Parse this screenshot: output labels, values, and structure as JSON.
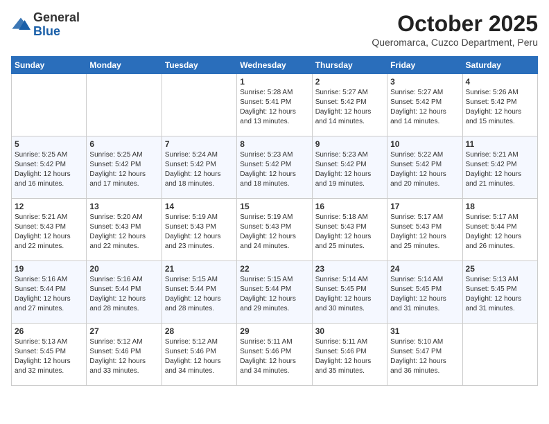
{
  "header": {
    "logo_line1": "General",
    "logo_line2": "Blue",
    "month": "October 2025",
    "location": "Queromarca, Cuzco Department, Peru"
  },
  "weekdays": [
    "Sunday",
    "Monday",
    "Tuesday",
    "Wednesday",
    "Thursday",
    "Friday",
    "Saturday"
  ],
  "weeks": [
    [
      {
        "day": "",
        "info": ""
      },
      {
        "day": "",
        "info": ""
      },
      {
        "day": "",
        "info": ""
      },
      {
        "day": "1",
        "info": "Sunrise: 5:28 AM\nSunset: 5:41 PM\nDaylight: 12 hours\nand 13 minutes."
      },
      {
        "day": "2",
        "info": "Sunrise: 5:27 AM\nSunset: 5:42 PM\nDaylight: 12 hours\nand 14 minutes."
      },
      {
        "day": "3",
        "info": "Sunrise: 5:27 AM\nSunset: 5:42 PM\nDaylight: 12 hours\nand 14 minutes."
      },
      {
        "day": "4",
        "info": "Sunrise: 5:26 AM\nSunset: 5:42 PM\nDaylight: 12 hours\nand 15 minutes."
      }
    ],
    [
      {
        "day": "5",
        "info": "Sunrise: 5:25 AM\nSunset: 5:42 PM\nDaylight: 12 hours\nand 16 minutes."
      },
      {
        "day": "6",
        "info": "Sunrise: 5:25 AM\nSunset: 5:42 PM\nDaylight: 12 hours\nand 17 minutes."
      },
      {
        "day": "7",
        "info": "Sunrise: 5:24 AM\nSunset: 5:42 PM\nDaylight: 12 hours\nand 18 minutes."
      },
      {
        "day": "8",
        "info": "Sunrise: 5:23 AM\nSunset: 5:42 PM\nDaylight: 12 hours\nand 18 minutes."
      },
      {
        "day": "9",
        "info": "Sunrise: 5:23 AM\nSunset: 5:42 PM\nDaylight: 12 hours\nand 19 minutes."
      },
      {
        "day": "10",
        "info": "Sunrise: 5:22 AM\nSunset: 5:42 PM\nDaylight: 12 hours\nand 20 minutes."
      },
      {
        "day": "11",
        "info": "Sunrise: 5:21 AM\nSunset: 5:42 PM\nDaylight: 12 hours\nand 21 minutes."
      }
    ],
    [
      {
        "day": "12",
        "info": "Sunrise: 5:21 AM\nSunset: 5:43 PM\nDaylight: 12 hours\nand 22 minutes."
      },
      {
        "day": "13",
        "info": "Sunrise: 5:20 AM\nSunset: 5:43 PM\nDaylight: 12 hours\nand 22 minutes."
      },
      {
        "day": "14",
        "info": "Sunrise: 5:19 AM\nSunset: 5:43 PM\nDaylight: 12 hours\nand 23 minutes."
      },
      {
        "day": "15",
        "info": "Sunrise: 5:19 AM\nSunset: 5:43 PM\nDaylight: 12 hours\nand 24 minutes."
      },
      {
        "day": "16",
        "info": "Sunrise: 5:18 AM\nSunset: 5:43 PM\nDaylight: 12 hours\nand 25 minutes."
      },
      {
        "day": "17",
        "info": "Sunrise: 5:17 AM\nSunset: 5:43 PM\nDaylight: 12 hours\nand 25 minutes."
      },
      {
        "day": "18",
        "info": "Sunrise: 5:17 AM\nSunset: 5:44 PM\nDaylight: 12 hours\nand 26 minutes."
      }
    ],
    [
      {
        "day": "19",
        "info": "Sunrise: 5:16 AM\nSunset: 5:44 PM\nDaylight: 12 hours\nand 27 minutes."
      },
      {
        "day": "20",
        "info": "Sunrise: 5:16 AM\nSunset: 5:44 PM\nDaylight: 12 hours\nand 28 minutes."
      },
      {
        "day": "21",
        "info": "Sunrise: 5:15 AM\nSunset: 5:44 PM\nDaylight: 12 hours\nand 28 minutes."
      },
      {
        "day": "22",
        "info": "Sunrise: 5:15 AM\nSunset: 5:44 PM\nDaylight: 12 hours\nand 29 minutes."
      },
      {
        "day": "23",
        "info": "Sunrise: 5:14 AM\nSunset: 5:45 PM\nDaylight: 12 hours\nand 30 minutes."
      },
      {
        "day": "24",
        "info": "Sunrise: 5:14 AM\nSunset: 5:45 PM\nDaylight: 12 hours\nand 31 minutes."
      },
      {
        "day": "25",
        "info": "Sunrise: 5:13 AM\nSunset: 5:45 PM\nDaylight: 12 hours\nand 31 minutes."
      }
    ],
    [
      {
        "day": "26",
        "info": "Sunrise: 5:13 AM\nSunset: 5:45 PM\nDaylight: 12 hours\nand 32 minutes."
      },
      {
        "day": "27",
        "info": "Sunrise: 5:12 AM\nSunset: 5:46 PM\nDaylight: 12 hours\nand 33 minutes."
      },
      {
        "day": "28",
        "info": "Sunrise: 5:12 AM\nSunset: 5:46 PM\nDaylight: 12 hours\nand 34 minutes."
      },
      {
        "day": "29",
        "info": "Sunrise: 5:11 AM\nSunset: 5:46 PM\nDaylight: 12 hours\nand 34 minutes."
      },
      {
        "day": "30",
        "info": "Sunrise: 5:11 AM\nSunset: 5:46 PM\nDaylight: 12 hours\nand 35 minutes."
      },
      {
        "day": "31",
        "info": "Sunrise: 5:10 AM\nSunset: 5:47 PM\nDaylight: 12 hours\nand 36 minutes."
      },
      {
        "day": "",
        "info": ""
      }
    ]
  ]
}
